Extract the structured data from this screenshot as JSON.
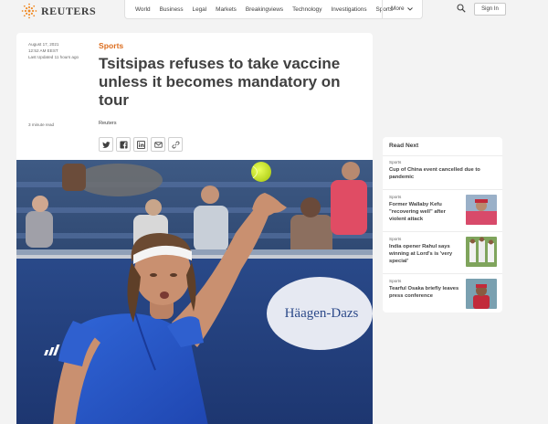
{
  "header": {
    "brand": "REUTERS",
    "nav": [
      "World",
      "Business",
      "Legal",
      "Markets",
      "Breakingviews",
      "Technology",
      "Investigations",
      "Sports"
    ],
    "more_label": "More",
    "signin_label": "Sign In"
  },
  "article": {
    "date": "August 17, 2021",
    "time": "12:52 AM EEST",
    "updated": "Last Updated 11 hours ago",
    "read_time": "3 minute read",
    "category": "Sports",
    "headline": "Tsitsipas refuses to take vaccine unless it becomes mandatory on tour",
    "byline": "Reuters",
    "share_icons": [
      "twitter-icon",
      "facebook-icon",
      "linkedin-icon",
      "email-icon",
      "link-icon"
    ],
    "photo_sign": "Häagen-Dazs"
  },
  "read_next": {
    "title": "Read Next",
    "items": [
      {
        "category": "Sports",
        "headline": "Cup of China event cancelled due to pandemic"
      },
      {
        "category": "Sports",
        "headline": "Former Wallaby Kefu \"recovering well\" after violent attack"
      },
      {
        "category": "Sports",
        "headline": "India opener Rahul says winning at Lord's is 'very special'"
      },
      {
        "category": "Sports",
        "headline": "Tearful Osaka briefly leaves press conference"
      }
    ]
  },
  "colors": {
    "accent": "#dc6d1e",
    "text": "#404040",
    "page_bg": "#f3f3f3"
  }
}
